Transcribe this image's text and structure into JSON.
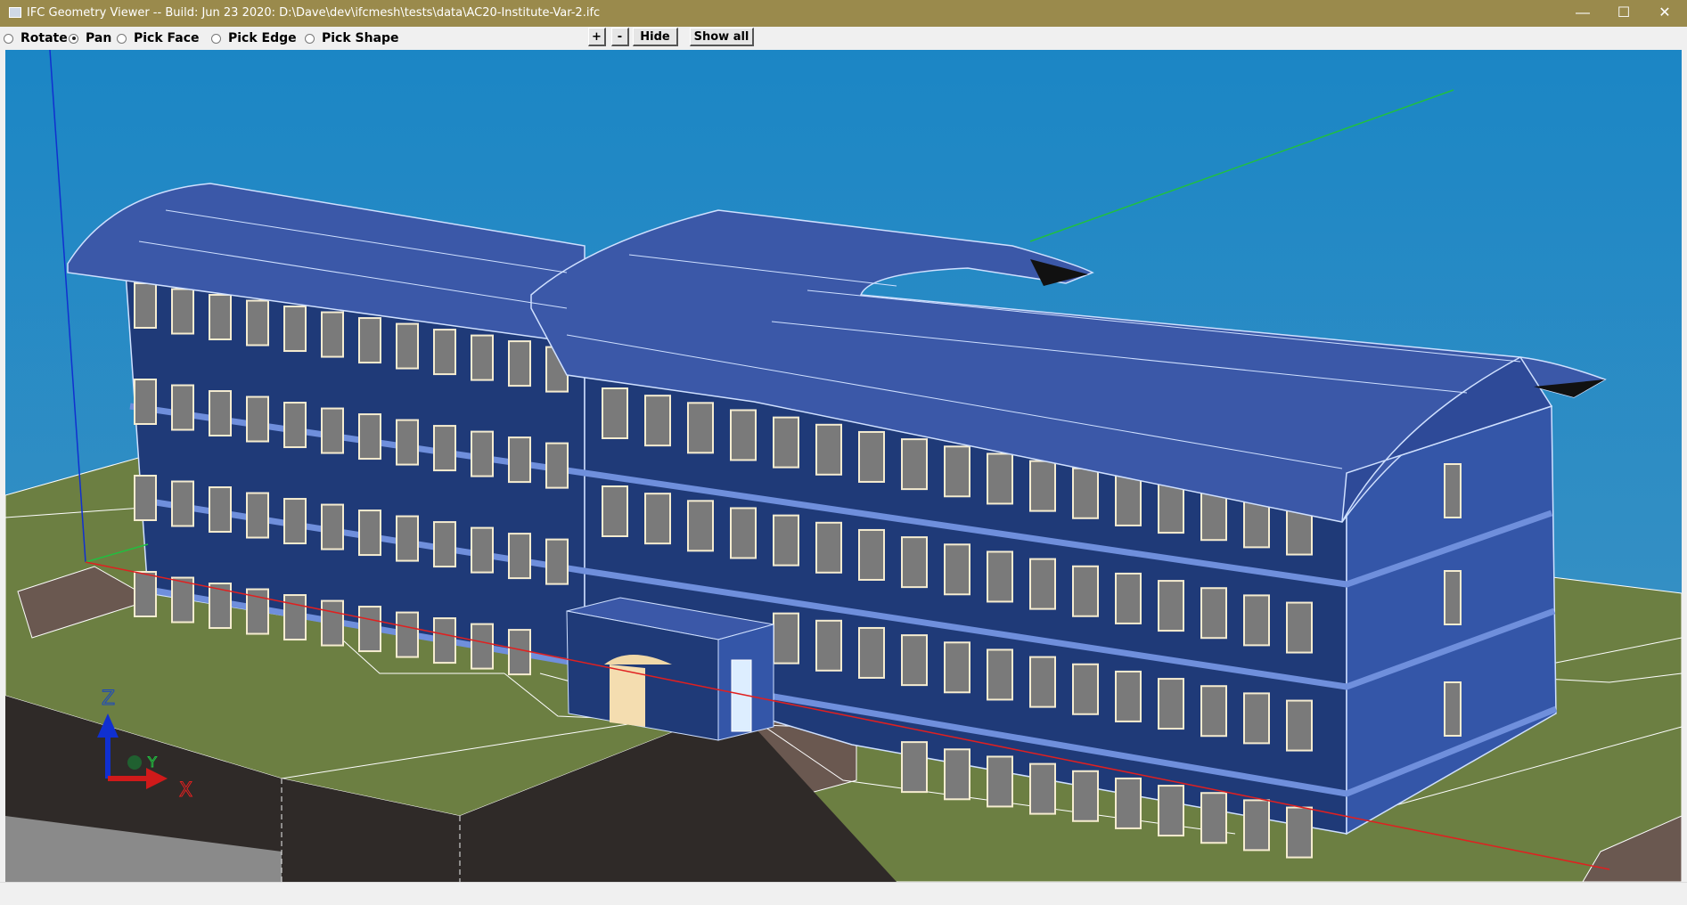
{
  "window": {
    "title": "IFC Geometry Viewer -- Build: Jun 23 2020: D:\\Dave\\dev\\ifcmesh\\tests\\data\\AC20-Institute-Var-2.ifc",
    "minimize": "—",
    "maximize": "☐",
    "close": "✕"
  },
  "toolbar": {
    "modes": [
      {
        "label": "Rotate",
        "selected": false
      },
      {
        "label": "Pan",
        "selected": true
      },
      {
        "label": "Pick Face",
        "selected": false
      },
      {
        "label": "Pick Edge",
        "selected": false
      },
      {
        "label": "Pick Shape",
        "selected": false
      }
    ],
    "zoom_in_label": "+",
    "zoom_out_label": "-",
    "hide_label": "Hide",
    "show_all_label": "Show all"
  },
  "viewport": {
    "axis_labels": {
      "z": "Z",
      "y": "Y",
      "x": "X"
    },
    "colors": {
      "sky_top": "#1b86c5",
      "sky_bottom": "#4194c4",
      "ground": "#6c7f42",
      "building": "#1f3a78",
      "roof": "#3b58a8",
      "x_axis": "#e02020",
      "y_axis": "#20c040",
      "z_axis": "#1030d0"
    }
  }
}
